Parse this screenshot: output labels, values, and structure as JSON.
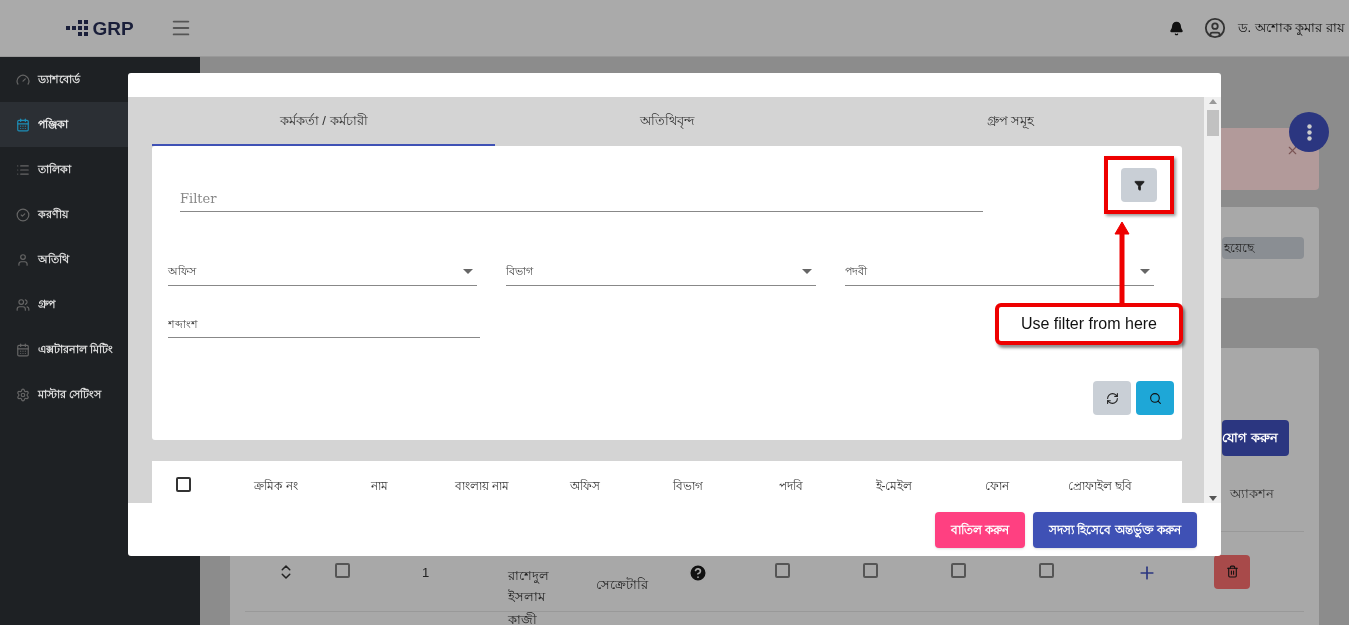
{
  "topbar": {
    "logo": "GRP",
    "user_name": "ড. অশোক কুমার রায়"
  },
  "sidebar": {
    "items": [
      {
        "label": "ড্যাশবোর্ড",
        "selected": false
      },
      {
        "label": "পঞ্জিকা",
        "selected": true
      },
      {
        "label": "তালিকা",
        "selected": false
      },
      {
        "label": "করণীয়",
        "selected": false
      },
      {
        "label": "অতিথি",
        "selected": false
      },
      {
        "label": "গ্রুপ",
        "selected": false
      },
      {
        "label": "এক্সটারনাল মিটিং",
        "selected": false
      },
      {
        "label": "মাস্টার সেটিংস",
        "selected": false
      }
    ]
  },
  "background": {
    "status_chip": "হয়েছে",
    "add_button": "যোগ করুন",
    "action_header": "অ্যাকশন",
    "rows": [
      {
        "checked": false,
        "serial": "1",
        "name": "রাশেদুল ইসলাম",
        "designation": "সেক্রেটারি",
        "checks": [
          false,
          false,
          false,
          false
        ]
      },
      {
        "name": "কাজী"
      }
    ]
  },
  "modal": {
    "tabs": [
      {
        "label": "কর্মকর্তা / কর্মচারী",
        "selected": true
      },
      {
        "label": "অতিথিবৃন্দ",
        "selected": false
      },
      {
        "label": "গ্রুপ সমূহ",
        "selected": false
      }
    ],
    "filter": {
      "placeholder": "Filter"
    },
    "selects": [
      {
        "label": "অফিস"
      },
      {
        "label": "বিভাগ"
      },
      {
        "label": "পদবী"
      }
    ],
    "keyword": {
      "placeholder": "শব্দাংশ"
    },
    "table": {
      "select_all": false,
      "columns": [
        "ক্রমিক নং",
        "নাম",
        "বাংলায় নাম",
        "অফিস",
        "বিভাগ",
        "পদবি",
        "ই-মেইল",
        "ফোন",
        "প্রোফাইল ছবি"
      ]
    },
    "buttons": {
      "cancel": "বাতিল করুন",
      "add": "সদস্য হিসেবে অন্তর্ভুক্ত করুন"
    },
    "callout": "Use filter from here"
  }
}
